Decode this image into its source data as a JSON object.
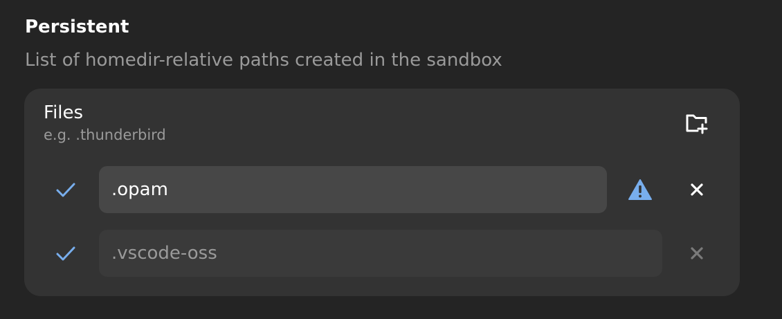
{
  "section": {
    "title": "Persistent",
    "description": "List of homedir-relative paths created in the sandbox"
  },
  "files_group": {
    "title": "Files",
    "subtitle": "e.g. .thunderbird",
    "add_icon": "folder-plus-icon"
  },
  "entries": [
    {
      "value": ".opam",
      "status_icon": "check-icon",
      "warning_icon": "warning-triangle-icon",
      "remove_icon": "close-icon",
      "remove_enabled": true
    },
    {
      "value": ".vscode-oss",
      "status_icon": "check-icon",
      "remove_icon": "close-icon",
      "remove_enabled": false
    }
  ],
  "colors": {
    "background": "#242424",
    "card": "#333333",
    "entry_active": "#474747",
    "entry_inactive": "#3a3a3a",
    "accent": "#78aeed",
    "dim_text": "#9a9a9a"
  }
}
